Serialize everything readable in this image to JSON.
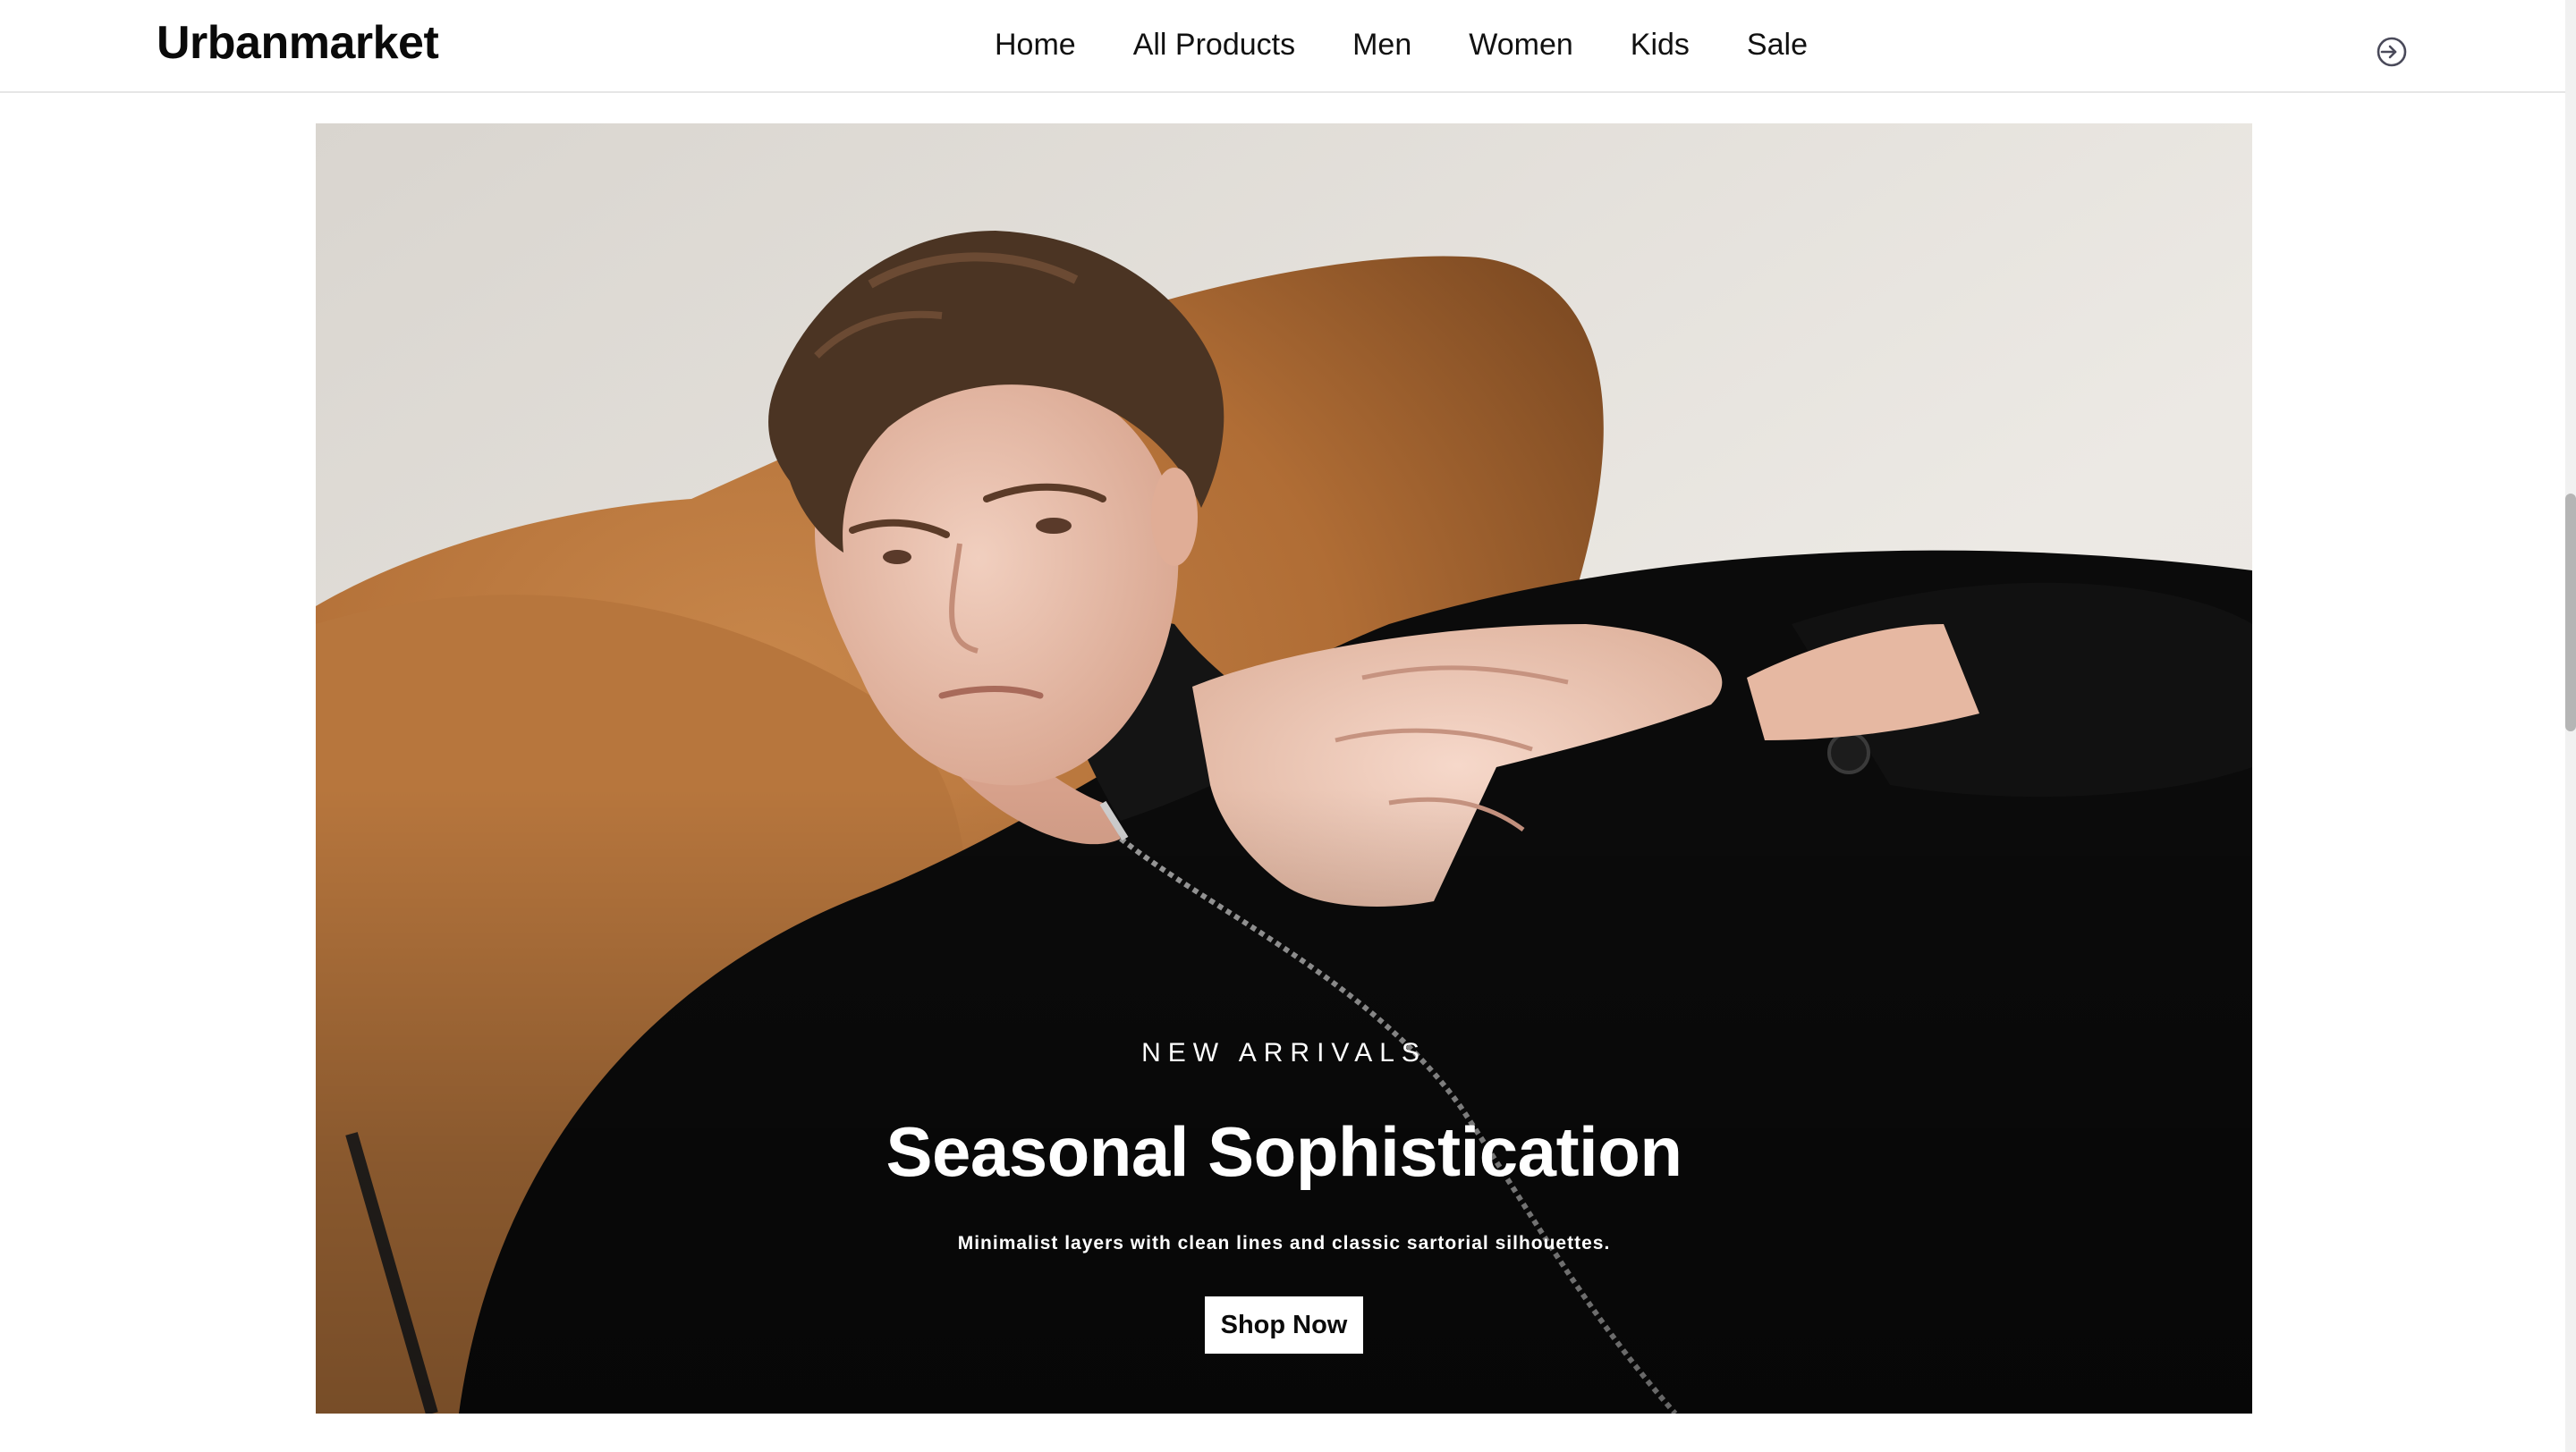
{
  "header": {
    "brand": "Urbanmarket",
    "nav": [
      "Home",
      "All Products",
      "Men",
      "Women",
      "Kids",
      "Sale"
    ],
    "login_icon": "login-circle-arrow-icon"
  },
  "hero": {
    "eyebrow": "NEW ARRIVALS",
    "title": "Seasonal Sophistication",
    "subtitle": "Minimalist layers with clean lines and classic sartorial silhouettes.",
    "cta_label": "Shop Now",
    "image": "hero-photo-man-black-jacket-on-tan-chair"
  },
  "colors": {
    "text": "#111111",
    "chair": "#b9773f",
    "jacket": "#0b0b0b",
    "wall": "#e7e4df",
    "button_bg": "#ffffff"
  }
}
